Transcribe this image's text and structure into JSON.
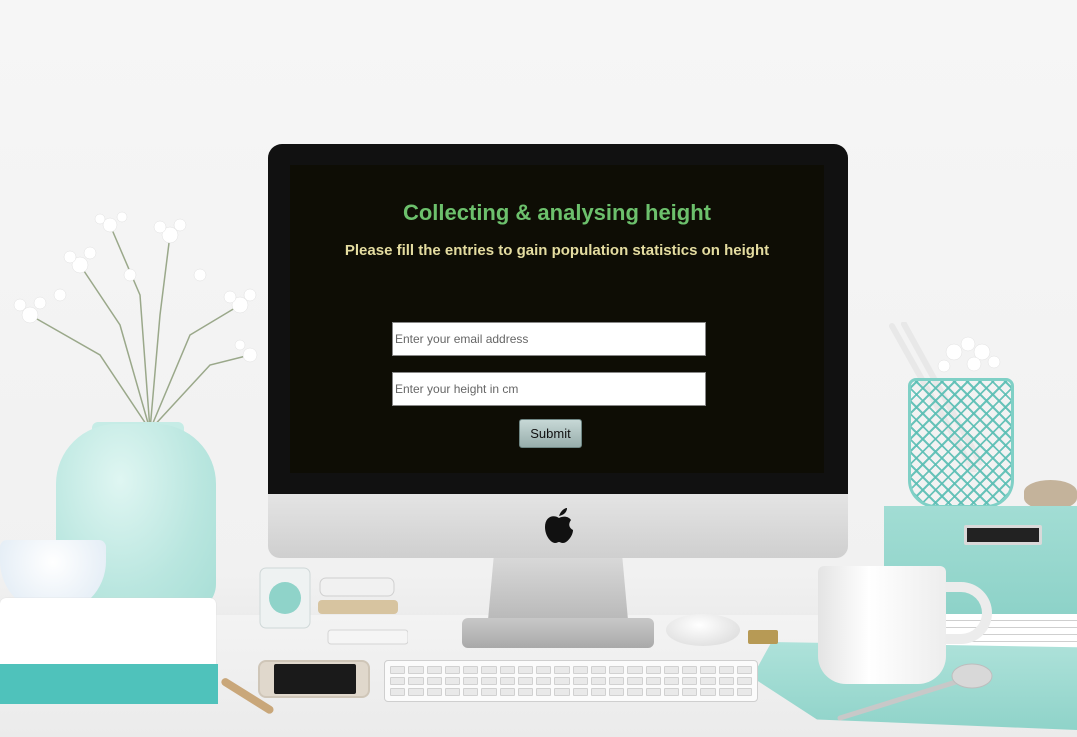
{
  "page": {
    "title": "Collecting & analysing height",
    "subtitle": "Please fill the entries to gain population statistics on height"
  },
  "form": {
    "email_placeholder": "Enter your email address",
    "email_value": "",
    "height_placeholder": "Enter your height in cm",
    "height_value": "",
    "submit_label": "Submit"
  },
  "colors": {
    "screen_background": "#0e0d05",
    "title_color": "#6cc06c",
    "subtitle_color": "#e4dca0",
    "submit_button": "#aec4c2"
  },
  "icons": {
    "monitor_logo": "apple-logo-icon"
  }
}
